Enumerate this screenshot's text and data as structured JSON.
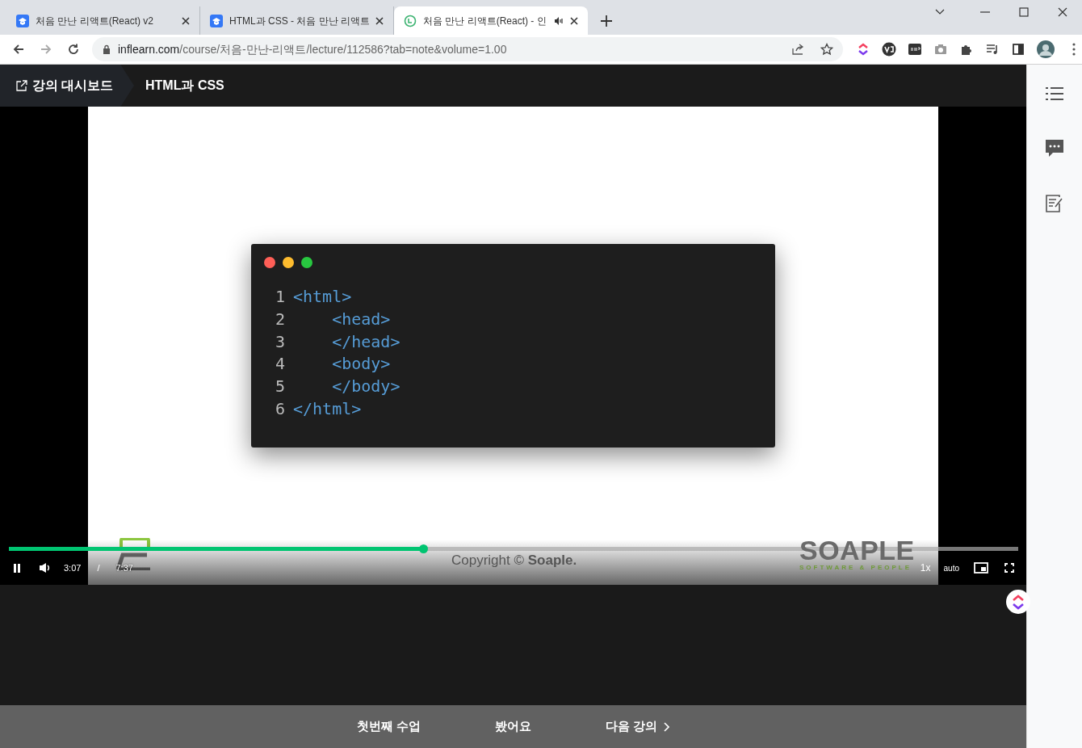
{
  "browser": {
    "tabs": [
      {
        "title": "처음 만난 리액트(React) v2",
        "selected": false,
        "audio": false
      },
      {
        "title": "HTML과 CSS - 처음 만난 리액트",
        "selected": false,
        "audio": false
      },
      {
        "title": "처음 만난 리액트(React) - 인",
        "selected": true,
        "audio": true
      }
    ],
    "address_host": "inflearn.com",
    "address_path": "/course/처음-만난-리액트/lecture/112586?tab=note&volume=1.00"
  },
  "header": {
    "dashboard_link": "강의 대시보드",
    "lecture_title": "HTML과 CSS"
  },
  "slide": {
    "code_lines": [
      {
        "number": "1",
        "code": "<html>"
      },
      {
        "number": "2",
        "code": "    <head>"
      },
      {
        "number": "3",
        "code": "    </head>"
      },
      {
        "number": "4",
        "code": "    <body>"
      },
      {
        "number": "5",
        "code": "    </body>"
      },
      {
        "number": "6",
        "code": "</html>"
      }
    ],
    "copyright": "Copyright © **Soaple.**",
    "logo": "SOAPLE",
    "logo_tagline": "SOFTWARE & PEOPLE"
  },
  "player": {
    "playing": true,
    "level": 0.41,
    "current_time": "3:07",
    "separator": "/",
    "duration": "7:37",
    "speed": "1x",
    "quality": "auto"
  },
  "bottom_bar": [
    {
      "label": "첫번째 수업",
      "kind": "plain"
    },
    {
      "label": "봤어요",
      "kind": "plain"
    },
    {
      "label": "다음 강의",
      "kind": "next"
    }
  ]
}
